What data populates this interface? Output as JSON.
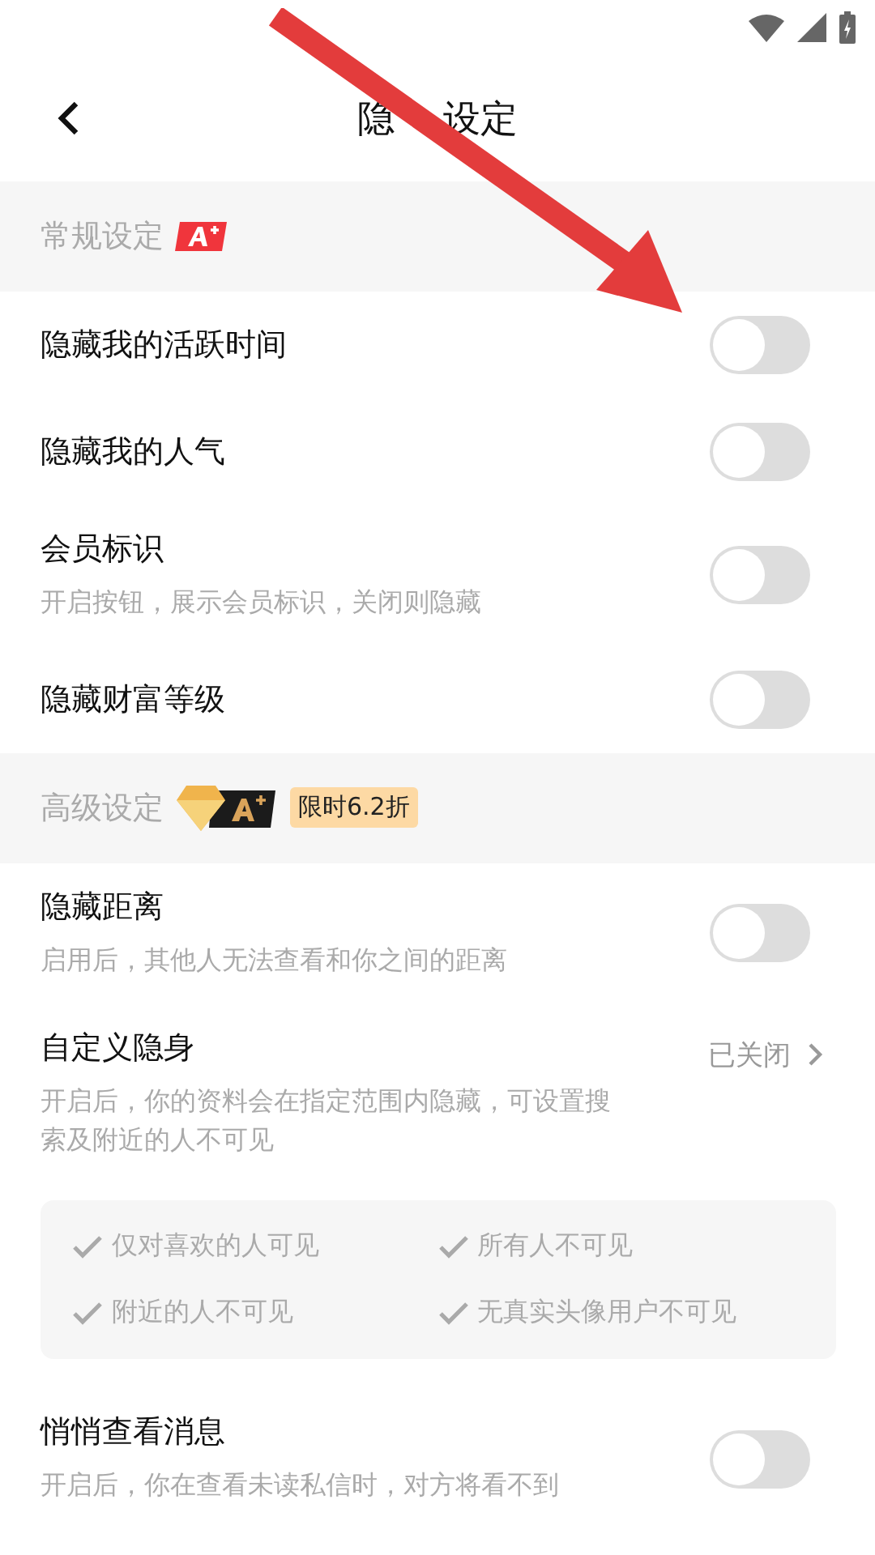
{
  "header": {
    "title_visible_parts": [
      "隐",
      "设定"
    ]
  },
  "sections": [
    {
      "title": "常规设定",
      "badge": {
        "kind": "red"
      },
      "items": [
        {
          "kind": "toggle",
          "label": "隐藏我的活跃时间",
          "on": false
        },
        {
          "kind": "toggle",
          "label": "隐藏我的人气",
          "on": false
        },
        {
          "kind": "toggle",
          "label": "会员标识",
          "desc": "开启按钮，展示会员标识，关闭则隐藏",
          "on": false
        },
        {
          "kind": "toggle",
          "label": "隐藏财富等级",
          "on": false
        }
      ]
    },
    {
      "title": "高级设定",
      "badge": {
        "kind": "gold"
      },
      "promo": "限时6.2折",
      "items": [
        {
          "kind": "toggle",
          "label": "隐藏距离",
          "desc": "启用后，其他人无法查看和你之间的距离",
          "on": false
        },
        {
          "kind": "link",
          "label": "自定义隐身",
          "desc": "开启后，你的资料会在指定范围内隐藏，可设置搜索及附近的人不可见",
          "value": "已关闭",
          "options": [
            "仅对喜欢的人可见",
            "所有人不可见",
            "附近的人不可见",
            "无真实头像用户不可见"
          ]
        },
        {
          "kind": "toggle",
          "label": "悄悄查看消息",
          "desc": "开启后，你在查看未读私信时，对方将看不到",
          "on": false
        }
      ]
    }
  ]
}
